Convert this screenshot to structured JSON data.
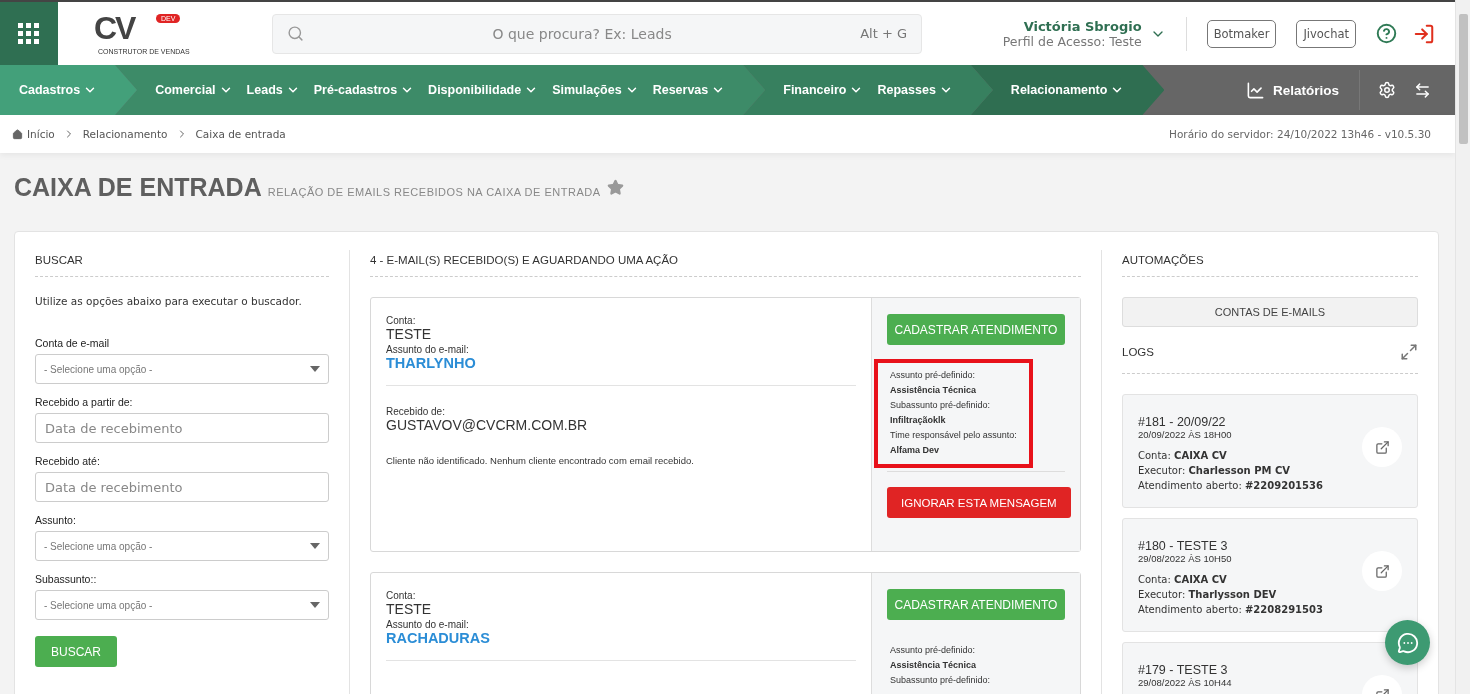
{
  "header": {
    "logo": {
      "letters": "CV",
      "badge": "DEV",
      "tagline": "CONSTRUTOR DE VENDAS"
    },
    "search": {
      "placeholder": "O que procura? Ex: Leads",
      "shortcut": "Alt + G"
    },
    "user": {
      "name": "Victória Sbrogio",
      "profile": "Perfil de Acesso: Teste"
    },
    "buttons": [
      "Botmaker",
      "Jivochat"
    ]
  },
  "nav": {
    "groups": [
      {
        "color": "#43a07a",
        "items": [
          "Cadastros"
        ]
      },
      {
        "color": "#3d8b68",
        "items": [
          "Comercial",
          "Leads",
          "Pré-cadastros",
          "Disponibilidade",
          "Simulações",
          "Reservas"
        ]
      },
      {
        "color": "#37805f",
        "items": [
          "Financeiro",
          "Repasses"
        ]
      },
      {
        "color": "#2f6e51",
        "items": [
          "Relacionamento"
        ]
      }
    ],
    "reports": "Relatórios"
  },
  "breadcrumb": [
    "Início",
    "Relacionamento",
    "Caixa de entrada"
  ],
  "server_time": "Horário do servidor: 24/10/2022 13h46 - v10.5.30",
  "page": {
    "title": "CAIXA DE ENTRADA",
    "subtitle": "RELAÇÃO DE EMAILS RECEBIDOS NA CAIXA DE ENTRADA",
    "favorite": false
  },
  "search_panel": {
    "title": "BUSCAR",
    "hint": "Utilize as opções abaixo para executar o buscador.",
    "fields": [
      {
        "kind": "select",
        "label": "Conta de e-mail",
        "placeholder": "- Selecione uma opção -"
      },
      {
        "kind": "text",
        "label": "Recebido a partir de:",
        "placeholder": "Data de recebimento"
      },
      {
        "kind": "text",
        "label": "Recebido até:",
        "placeholder": "Data de recebimento"
      },
      {
        "kind": "select",
        "label": "Assunto:",
        "placeholder": "- Selecione uma opção -"
      },
      {
        "kind": "select",
        "label": "Subassunto::",
        "placeholder": "- Selecione uma opção -"
      }
    ],
    "button": "BUSCAR"
  },
  "emails": {
    "title": "4 - E-MAIL(S) RECEBIDO(S) E AGUARDANDO UMA AÇÃO",
    "items": [
      {
        "account_label": "Conta:",
        "account": "TESTE",
        "subject_label": "Assunto do e-mail:",
        "subject": "THARLYNHO",
        "from_label": "Recebido de:",
        "from": "GUSTAVOV@CVCRM.COM.BR",
        "note": "Cliente não identificado. Nenhum cliente encontrado com email recebido.",
        "register_button": "CADASTRAR ATENDIMENTO",
        "highlighted": true,
        "details": [
          {
            "label": "Assunto pré-definido:",
            "value": "Assistência Técnica"
          },
          {
            "label": "Subassunto pré-definido:",
            "value": "Infiltraçãoklk"
          },
          {
            "label": "Time responsável pelo assunto:",
            "value": "Alfama Dev"
          }
        ],
        "ignore_button": "IGNORAR ESTA MENSAGEM"
      },
      {
        "account_label": "Conta:",
        "account": "TESTE",
        "subject_label": "Assunto do e-mail:",
        "subject": "RACHADURAS",
        "register_button": "CADASTRAR ATENDIMENTO",
        "highlighted": false,
        "details": [
          {
            "label": "Assunto pré-definido:",
            "value": "Assistência Técnica"
          },
          {
            "label": "Subassunto pré-definido:"
          }
        ]
      }
    ]
  },
  "automations": {
    "title": "AUTOMAÇÕES",
    "button": "CONTAS DE E-MAILS",
    "logs_title": "LOGS",
    "logs": [
      {
        "title": "#181 - 20/09/22",
        "date": "20/09/2022 ÀS 18H00",
        "lines": [
          "Conta: **CAIXA CV**",
          "Executor: **Charlesson PM CV**",
          "Atendimento aberto: **#2209201536**"
        ]
      },
      {
        "title": "#180 - TESTE 3",
        "date": "29/08/2022 ÀS 10H50",
        "lines": [
          "Conta: **CAIXA CV**",
          "Executor: **Tharlysson DEV**",
          "Atendimento aberto: **#2208291503**"
        ]
      },
      {
        "title": "#179 - TESTE 3",
        "date": "29/08/2022 ÀS 10H44"
      }
    ]
  }
}
